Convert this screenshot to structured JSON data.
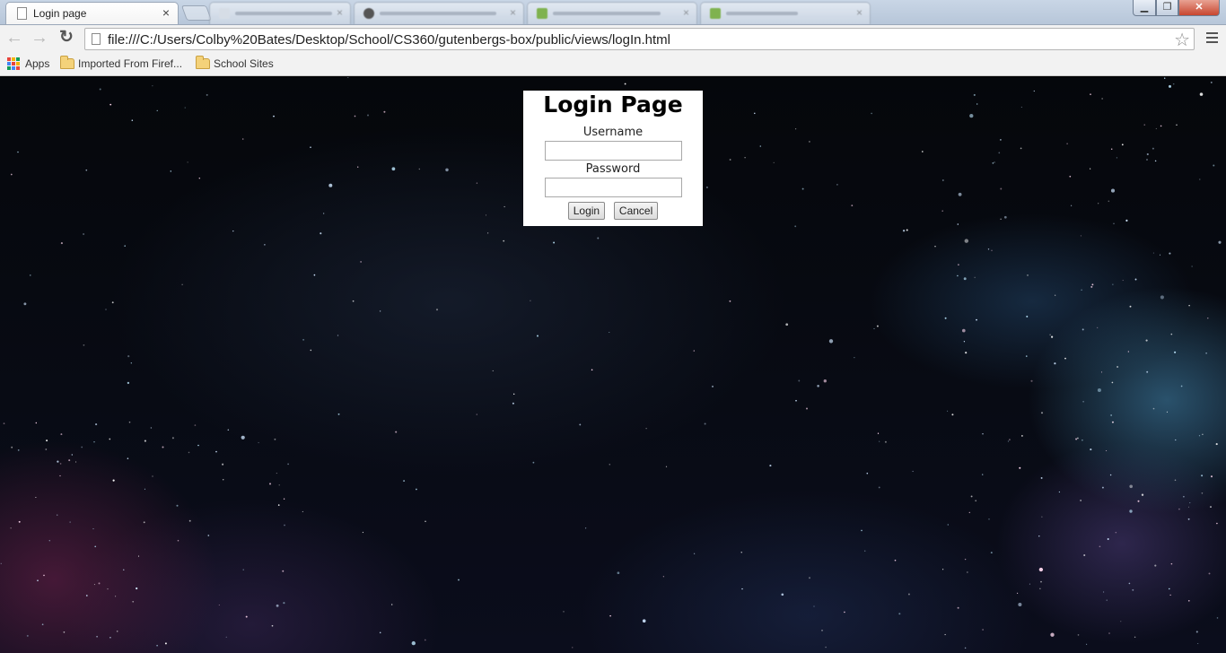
{
  "browser": {
    "active_tab": {
      "title": "Login page"
    },
    "address_bar": {
      "url": "file:///C:/Users/Colby%20Bates/Desktop/School/CS360/gutenbergs-box/public/views/logIn.html"
    },
    "bookmarks": [
      {
        "label": "Apps",
        "icon": "apps-grid-icon"
      },
      {
        "label": "Imported From Firef...",
        "icon": "folder-icon"
      },
      {
        "label": "School Sites",
        "icon": "folder-icon"
      }
    ]
  },
  "page": {
    "title": "Login Page",
    "username_label": "Username",
    "username_value": "",
    "password_label": "Password",
    "password_value": "",
    "login_button": "Login",
    "cancel_button": "Cancel"
  },
  "icons": {
    "tab_close": "×",
    "back": "←",
    "forward": "→",
    "reload": "↻",
    "star": "☆",
    "window_minimize": "▁",
    "window_maximize": "❐",
    "window_close": "✕"
  },
  "colors": {
    "tab_strip": "#c9d6e6",
    "toolbar": "#f2f2f2",
    "close_button": "#c8462f",
    "login_panel": "#ffffff",
    "space_background": "#05070b"
  }
}
